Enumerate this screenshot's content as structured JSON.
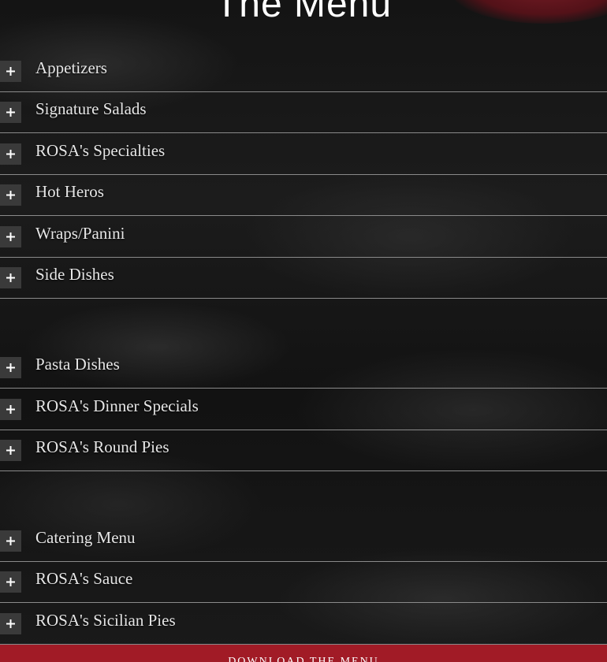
{
  "page_title": "The Menu",
  "sections": [
    {
      "label": "Appetizers"
    },
    {
      "label": "Signature Salads"
    },
    {
      "label": "ROSA's Specialties"
    },
    {
      "label": "Hot Heros"
    },
    {
      "label": "Wraps/Panini"
    },
    {
      "label": "Side Dishes"
    },
    {
      "label": "Pasta Dishes"
    },
    {
      "label": "ROSA's Dinner Specials"
    },
    {
      "label": "ROSA's Round Pies"
    },
    {
      "label": "Catering Menu"
    },
    {
      "label": "ROSA's Sauce"
    },
    {
      "label": "ROSA's Sicilian Pies"
    }
  ],
  "toggle_icon": "plus-icon",
  "download_label": "DOWNLOAD THE MENU",
  "colors": {
    "accent": "#a11b26",
    "toggle_bg": "#3a3a3a",
    "divider": "#8a8a8a",
    "text": "#e6e6e6"
  }
}
